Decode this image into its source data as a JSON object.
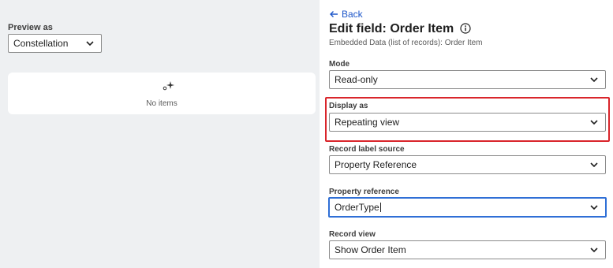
{
  "preview": {
    "label": "Preview as",
    "selected": "Constellation",
    "empty_text": "No items"
  },
  "editor": {
    "back_label": "Back",
    "title": "Edit field: Order Item",
    "subtitle": "Embedded Data (list of records): Order Item",
    "fields": [
      {
        "label": "Mode",
        "value": "Read-only"
      },
      {
        "label": "Display as",
        "value": "Repeating view"
      },
      {
        "label": "Record label source",
        "value": "Property Reference"
      },
      {
        "label": "Property reference",
        "value": "OrderType"
      },
      {
        "label": "Record view",
        "value": "Show Order Item"
      }
    ]
  },
  "colors": {
    "link": "#1d56c9",
    "highlight": "#d9252b",
    "focus": "#2f6fd6",
    "left_bg": "#eef0f2"
  },
  "icons": [
    "back-arrow-icon",
    "info-icon",
    "chevron-down-icon",
    "sparkle-icon"
  ]
}
